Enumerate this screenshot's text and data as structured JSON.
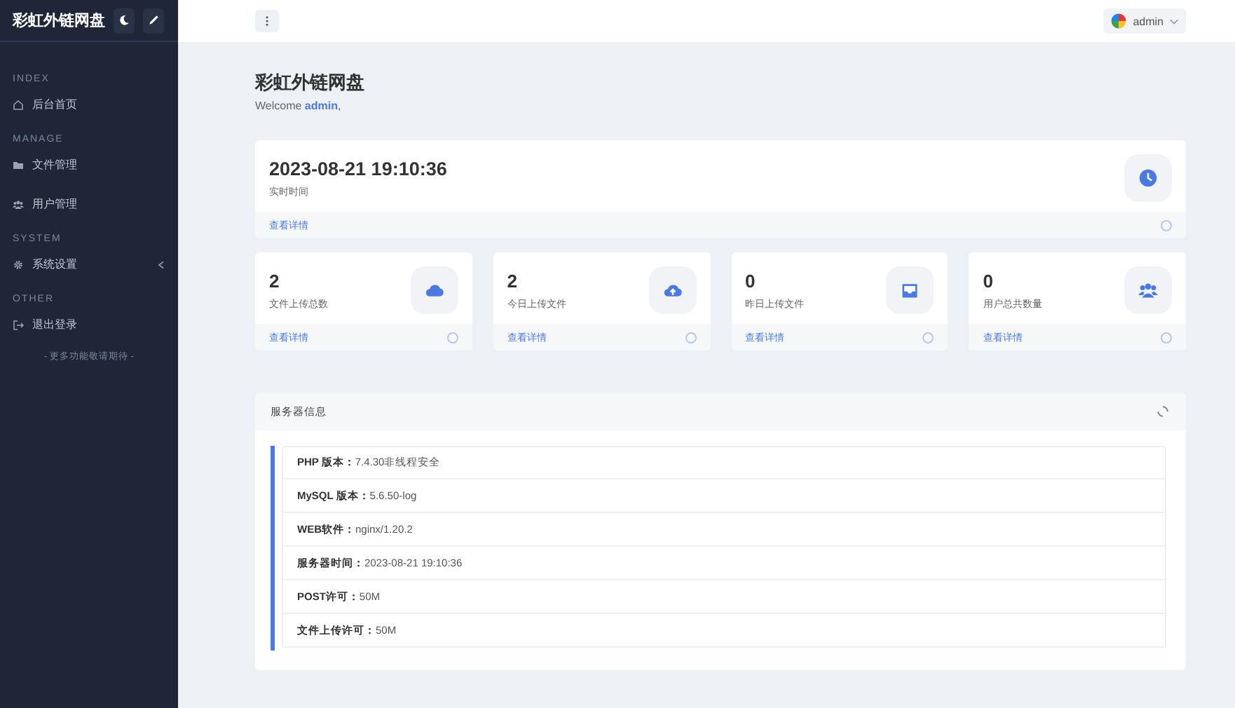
{
  "sidebar": {
    "brand": "彩虹外链网盘",
    "sections": [
      {
        "heading": "INDEX",
        "items": [
          {
            "label": "后台首页",
            "kind": "home",
            "expandable": false
          }
        ]
      },
      {
        "heading": "MANAGE",
        "items": [
          {
            "label": "文件管理",
            "kind": "folder",
            "expandable": false
          },
          {
            "label": "用户管理",
            "kind": "users",
            "expandable": false
          }
        ]
      },
      {
        "heading": "SYSTEM",
        "items": [
          {
            "label": "系统设置",
            "kind": "gear",
            "expandable": true
          }
        ]
      },
      {
        "heading": "OTHER",
        "items": [
          {
            "label": "退出登录",
            "kind": "logout",
            "expandable": false
          }
        ]
      }
    ],
    "footer": "- 更多功能敬请期待 -"
  },
  "topbar": {
    "user": "admin"
  },
  "page": {
    "title": "彩虹外链网盘",
    "welcome_prefix": "Welcome ",
    "welcome_user": "admin",
    "welcome_suffix": ","
  },
  "time_card": {
    "value": "2023-08-21 19:10:36",
    "label": "实时时间",
    "link": "查看详情"
  },
  "stats": [
    {
      "value": "2",
      "label": "文件上传总数",
      "kind": "cloud",
      "link": "查看详情"
    },
    {
      "value": "2",
      "label": "今日上传文件",
      "kind": "upload",
      "link": "查看详情"
    },
    {
      "value": "0",
      "label": "昨日上传文件",
      "kind": "inbox",
      "link": "查看详情"
    },
    {
      "value": "0",
      "label": "用户总共数量",
      "kind": "users",
      "link": "查看详情"
    }
  ],
  "server": {
    "title": "服务器信息",
    "rows": [
      {
        "label": "PHP 版本：",
        "value": "7.4.30非线程安全"
      },
      {
        "label": "MySQL 版本：",
        "value": "5.6.50-log"
      },
      {
        "label": "WEB软件：",
        "value": "nginx/1.20.2"
      },
      {
        "label": "服务器时间：",
        "value": "2023-08-21 19:10:36"
      },
      {
        "label": "POST许可：",
        "value": "50M"
      },
      {
        "label": "文件上传许可：",
        "value": "50M"
      }
    ]
  }
}
